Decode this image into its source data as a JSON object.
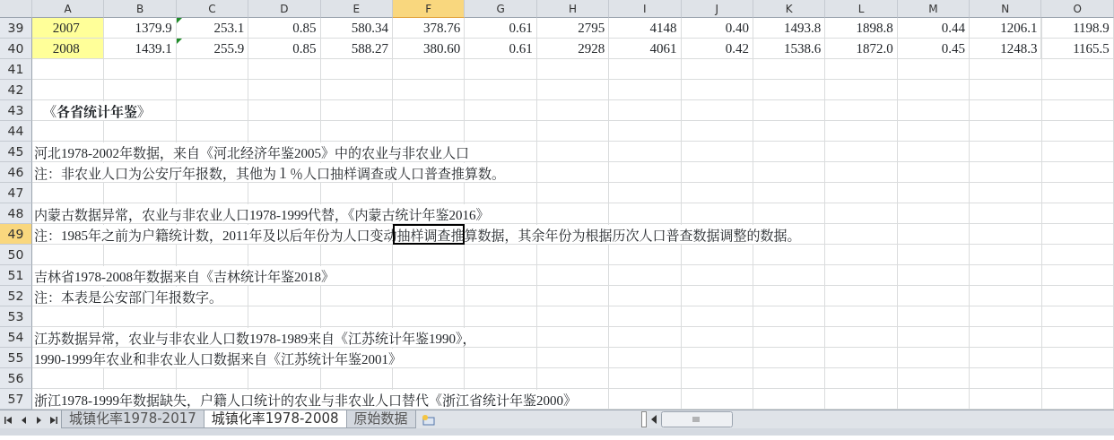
{
  "columns": [
    {
      "label": "A",
      "selected": false
    },
    {
      "label": "B",
      "selected": false
    },
    {
      "label": "C",
      "selected": false
    },
    {
      "label": "D",
      "selected": false
    },
    {
      "label": "E",
      "selected": false
    },
    {
      "label": "F",
      "selected": true
    },
    {
      "label": "G",
      "selected": false
    },
    {
      "label": "H",
      "selected": false
    },
    {
      "label": "I",
      "selected": false
    },
    {
      "label": "J",
      "selected": false
    },
    {
      "label": "K",
      "selected": false
    },
    {
      "label": "L",
      "selected": false
    },
    {
      "label": "M",
      "selected": false
    },
    {
      "label": "N",
      "selected": false
    },
    {
      "label": "O",
      "selected": false
    }
  ],
  "rows": [
    {
      "number": "39",
      "kind": "data",
      "selected": false,
      "cells": [
        {
          "value": "2007",
          "highlighted": true,
          "marker": false
        },
        {
          "value": "1379.9",
          "highlighted": false,
          "marker": false
        },
        {
          "value": "253.1",
          "highlighted": false,
          "marker": true
        },
        {
          "value": "0.85",
          "highlighted": false,
          "marker": false
        },
        {
          "value": "580.34",
          "highlighted": false,
          "marker": false
        },
        {
          "value": "378.76",
          "highlighted": false,
          "marker": false
        },
        {
          "value": "0.61",
          "highlighted": false,
          "marker": false
        },
        {
          "value": "2795",
          "highlighted": false,
          "marker": false
        },
        {
          "value": "4148",
          "highlighted": false,
          "marker": false
        },
        {
          "value": "0.40",
          "highlighted": false,
          "marker": false
        },
        {
          "value": "1493.8",
          "highlighted": false,
          "marker": false
        },
        {
          "value": "1898.8",
          "highlighted": false,
          "marker": false
        },
        {
          "value": "0.44",
          "highlighted": false,
          "marker": false
        },
        {
          "value": "1206.1",
          "highlighted": false,
          "marker": false
        },
        {
          "value": "1198.9",
          "highlighted": false,
          "marker": false
        }
      ]
    },
    {
      "number": "40",
      "kind": "data",
      "selected": false,
      "cells": [
        {
          "value": "2008",
          "highlighted": true,
          "marker": false
        },
        {
          "value": "1439.1",
          "highlighted": false,
          "marker": false
        },
        {
          "value": "255.9",
          "highlighted": false,
          "marker": true
        },
        {
          "value": "0.85",
          "highlighted": false,
          "marker": false
        },
        {
          "value": "588.27",
          "highlighted": false,
          "marker": false
        },
        {
          "value": "380.60",
          "highlighted": false,
          "marker": false
        },
        {
          "value": "0.61",
          "highlighted": false,
          "marker": false
        },
        {
          "value": "2928",
          "highlighted": false,
          "marker": false
        },
        {
          "value": "4061",
          "highlighted": false,
          "marker": false
        },
        {
          "value": "0.42",
          "highlighted": false,
          "marker": false
        },
        {
          "value": "1538.6",
          "highlighted": false,
          "marker": false
        },
        {
          "value": "1872.0",
          "highlighted": false,
          "marker": false
        },
        {
          "value": "0.45",
          "highlighted": false,
          "marker": false
        },
        {
          "value": "1248.3",
          "highlighted": false,
          "marker": false
        },
        {
          "value": "1165.5",
          "highlighted": false,
          "marker": false
        }
      ]
    },
    {
      "number": "41",
      "kind": "empty",
      "selected": false
    },
    {
      "number": "42",
      "kind": "empty",
      "selected": false
    },
    {
      "number": "43",
      "kind": "heading",
      "selected": false,
      "text": "《各省统计年鉴》"
    },
    {
      "number": "44",
      "kind": "empty",
      "selected": false
    },
    {
      "number": "45",
      "kind": "text",
      "selected": false,
      "text": "河北1978-2002年数据，来自《河北经济年鉴2005》中的农业与非农业人口"
    },
    {
      "number": "46",
      "kind": "text",
      "selected": false,
      "text": "注：非农业人口为公安厅年报数，其他为１％人口抽样调查或人口普查推算数。"
    },
    {
      "number": "47",
      "kind": "empty",
      "selected": false
    },
    {
      "number": "48",
      "kind": "text",
      "selected": false,
      "text": "内蒙古数据异常，农业与非农业人口1978-1999代替，《内蒙古统计年鉴2016》"
    },
    {
      "number": "49",
      "kind": "text",
      "selected": true,
      "text": "注：1985年之前为户籍统计数，2011年及以后年份为人口变动抽样调查推算数据，其余年份为根据历次人口普查数据调整的数据。"
    },
    {
      "number": "50",
      "kind": "empty",
      "selected": false
    },
    {
      "number": "51",
      "kind": "text",
      "selected": false,
      "text": "吉林省1978-2008年数据来自《吉林统计年鉴2018》"
    },
    {
      "number": "52",
      "kind": "text",
      "selected": false,
      "text": "注：本表是公安部门年报数字。"
    },
    {
      "number": "53",
      "kind": "empty",
      "selected": false
    },
    {
      "number": "54",
      "kind": "text",
      "selected": false,
      "text": "江苏数据异常，农业与非农业人口数1978-1989来自《江苏统计年鉴1990》，"
    },
    {
      "number": "55",
      "kind": "text",
      "selected": false,
      "text": "1990-1999年农业和非农业人口数据来自《江苏统计年鉴2001》"
    },
    {
      "number": "56",
      "kind": "empty",
      "selected": false
    },
    {
      "number": "57",
      "kind": "text",
      "selected": false,
      "text": "浙江1978-1999年数据缺失，户籍人口统计的农业与非农业人口替代《浙江省统计年鉴2000》"
    }
  ],
  "sheet_tabs": [
    {
      "label": "城镇化率1978-2017",
      "selected": false
    },
    {
      "label": "城镇化率1978-2008",
      "selected": true
    },
    {
      "label": "原始数据",
      "selected": false
    }
  ]
}
